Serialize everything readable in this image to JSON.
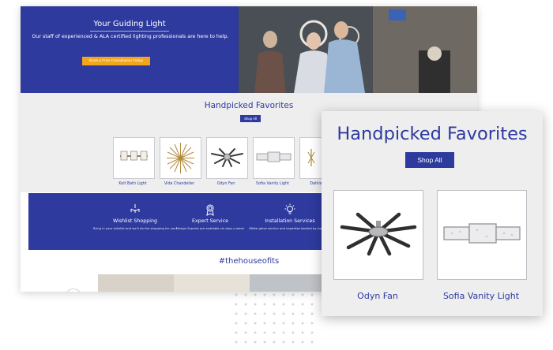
{
  "hero": {
    "title": "Your Guiding Light",
    "subtitle": "Our staff of experienced & ALA certified lighting professionals are here to help.",
    "cta_label": "Book a Free Consultation Today"
  },
  "favorites": {
    "title": "Handpicked Favorites",
    "shop_all_label": "Shop All",
    "products": [
      {
        "label": "Kolt Bath Light",
        "icon": "bath-light-fixture"
      },
      {
        "label": "Vida Chandelier",
        "icon": "chandelier"
      },
      {
        "label": "Odyn Fan",
        "icon": "ceiling-fan"
      },
      {
        "label": "Sofia Vanity Light",
        "icon": "vanity-light"
      },
      {
        "label": "Dahlia Ch",
        "icon": "chandelier"
      }
    ]
  },
  "features": [
    {
      "title": "Wishlist Shopping",
      "description": "Bring in your wishlist and we'll do the shopping for you!",
      "icon": "chandelier-icon"
    },
    {
      "title": "Expert Service",
      "description": "Design Experts are available six days a week",
      "icon": "award-ribbon-icon"
    },
    {
      "title": "Installation Services",
      "description": "White glove service and expertise backed by warranty",
      "icon": "lightbulb-icon"
    }
  ],
  "social": {
    "hashtag": "#thehouseofits"
  },
  "zoom_panel": {
    "title": "Handpicked Favorites",
    "shop_all_label": "Shop All",
    "products": [
      {
        "label": "Odyn Fan",
        "icon": "ceiling-fan"
      },
      {
        "label": "Sofia Vanity Light",
        "icon": "vanity-light"
      }
    ]
  },
  "colors": {
    "brand_blue": "#2e3a9e",
    "cta_orange": "#f3a61a",
    "section_gray": "#eeeeef"
  }
}
